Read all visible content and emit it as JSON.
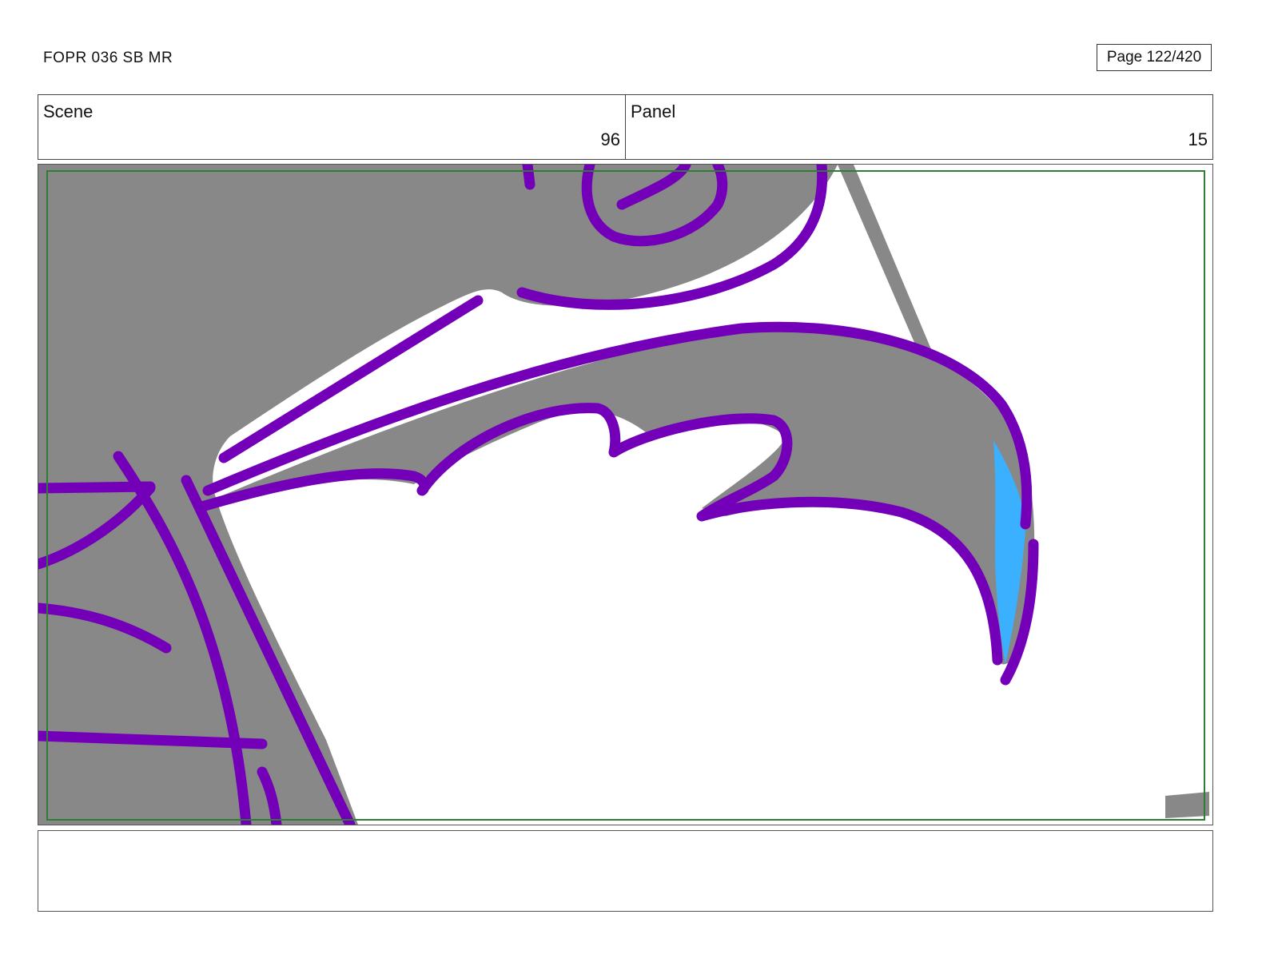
{
  "header": {
    "document_title": "FOPR 036 SB MR",
    "page_counter": "Page 122/420"
  },
  "info": {
    "scene_label": "Scene",
    "scene_value": "96",
    "panel_label": "Panel",
    "panel_value": "15"
  },
  "panel": {
    "colors": {
      "shadow_fill": "#888888",
      "line": "#7300b8",
      "highlight": "#3bb0ff",
      "safe_frame": "#2e7d32",
      "background": "#ffffff"
    }
  },
  "notes": {
    "text": ""
  }
}
